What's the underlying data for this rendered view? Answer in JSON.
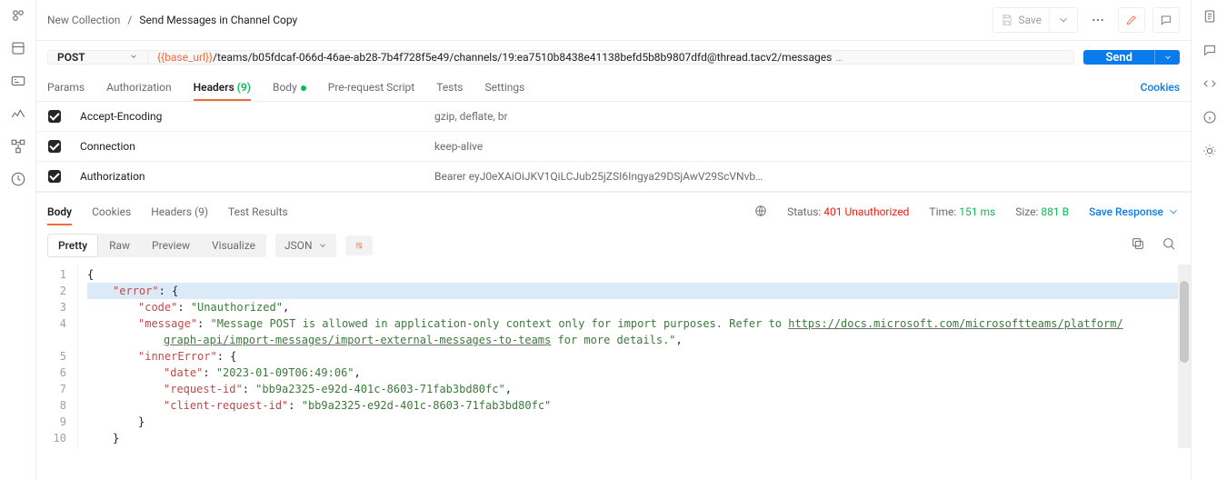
{
  "breadcrumb": {
    "collection": "New Collection",
    "sep": "/",
    "request": "Send Messages in Channel Copy"
  },
  "toolbar": {
    "save_label": "Save"
  },
  "request": {
    "method": "POST",
    "url_var": "{{base_url}}",
    "url_rest": "/teams/b05fdcaf-066d-46ae-ab28-7b4f728f5e49/channels/19:ea7510b8438e41138befd5b8b9807dfd@thread.tacv2/messages",
    "url_fade": "…",
    "send_label": "Send"
  },
  "req_tabs": {
    "params": "Params",
    "auth": "Authorization",
    "headers": "Headers",
    "headers_count": "(9)",
    "body": "Body",
    "prereq": "Pre-request Script",
    "tests": "Tests",
    "settings": "Settings",
    "cookies": "Cookies"
  },
  "headers_table": {
    "rows": [
      {
        "key": "Accept-Encoding",
        "value": "gzip, deflate, br"
      },
      {
        "key": "Connection",
        "value": "keep-alive"
      },
      {
        "key": "Authorization",
        "value": "Bearer eyJ0eXAiOiJKV1QiLCJub25jZSI6Ingya29DSjAwV29ScVNvb…"
      }
    ]
  },
  "res_tabs": {
    "body": "Body",
    "cookies": "Cookies",
    "headers": "Headers",
    "headers_count": "(9)",
    "tests": "Test Results",
    "status_k": "Status:",
    "status_v": "401 Unauthorized",
    "time_k": "Time:",
    "time_v": "151 ms",
    "size_k": "Size:",
    "size_v": "881 B",
    "save": "Save Response"
  },
  "pretty": {
    "pretty": "Pretty",
    "raw": "Raw",
    "preview": "Preview",
    "visualize": "Visualize",
    "fmt": "JSON"
  },
  "chart_data": {
    "type": "table",
    "title": "Response body (JSON)",
    "data": {
      "error": {
        "code": "Unauthorized",
        "message": "Message POST is allowed in application-only context only for import purposes. Refer to https://docs.microsoft.com/microsoftteams/platform/graph-api/import-messages/import-external-messages-to-teams for more details.",
        "innerError": {
          "date": "2023-01-09T06:49:06",
          "request-id": "bb9a2325-e92d-401c-8603-71fab3bd80fc",
          "client-request-id": "bb9a2325-e92d-401c-8603-71fab3bd80fc"
        }
      }
    }
  },
  "code": {
    "k_error": "\"error\"",
    "k_code": "\"code\"",
    "k_message": "\"message\"",
    "k_inner": "\"innerError\"",
    "k_date": "\"date\"",
    "k_reqid": "\"request-id\"",
    "k_clientreqid": "\"client-request-id\"",
    "v_code": "\"Unauthorized\"",
    "v_msg_a": "\"Message POST is allowed in application-only context only for import purposes. Refer to ",
    "v_msg_link1": "https://docs.microsoft.com/microsoftteams/platform/",
    "v_msg_link2": "graph-api/import-messages/import-external-messages-to-teams",
    "v_msg_b": " for more details.\"",
    "v_date": "\"2023-01-09T06:49:06\"",
    "v_reqid": "\"bb9a2325-e92d-401c-8603-71fab3bd80fc\"",
    "v_clientreqid": "\"bb9a2325-e92d-401c-8603-71fab3bd80fc\""
  },
  "line_numbers": [
    "1",
    "2",
    "3",
    "4",
    "",
    "5",
    "6",
    "7",
    "8",
    "9",
    "10"
  ]
}
